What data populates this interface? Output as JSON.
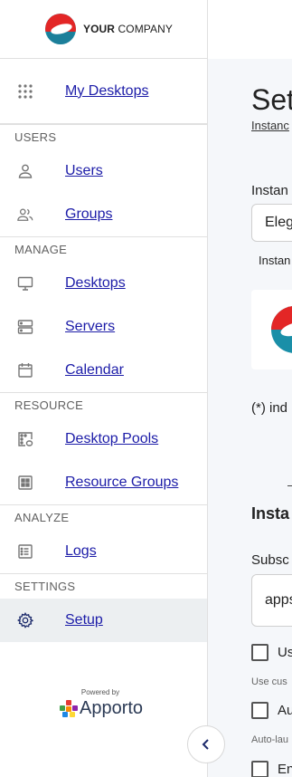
{
  "sidebar": {
    "logo_text_bold": "YOUR",
    "logo_text_rest": " COMPANY",
    "items": {
      "my_desktops": "My Desktops",
      "users": "Users",
      "groups": "Groups",
      "desktops": "Desktops",
      "servers": "Servers",
      "calendar": "Calendar",
      "desktop_pools": "Desktop Pools",
      "resource_groups": "Resource Groups",
      "logs": "Logs",
      "setup": "Setup"
    },
    "sections": {
      "users": "USERS",
      "manage": "MANAGE",
      "resource": "RESOURCE",
      "analyze": "ANALYZE",
      "settings": "SETTINGS"
    },
    "powered_by": "Powered by",
    "brand": "Apporto"
  },
  "main": {
    "title": "Set",
    "breadcrumb": "Instanc",
    "instance_label": "Instan",
    "instance_value": "Eleg",
    "instance_sub": "Instan",
    "indicates": "(*) ind",
    "dash": "–",
    "section_title": "Insta",
    "subscription_label": "Subsc",
    "subscription_value": "apps",
    "checkbox1_label": "Us",
    "hint1": "Use cus",
    "checkbox2_label": "Au",
    "hint2": "Auto-lau",
    "checkbox3_label": "En"
  },
  "colors": {
    "link": "#1c1ca8",
    "active_bg": "#eceff1",
    "brand_red": "#e32626",
    "brand_teal": "#1a8fa8"
  }
}
